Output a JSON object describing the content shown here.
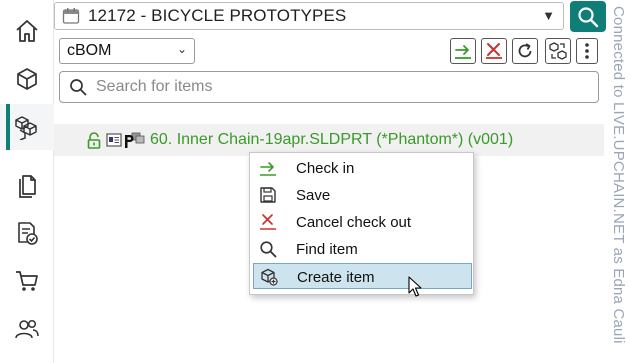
{
  "header": {
    "project_title": "12172 - BICYCLE PROTOTYPES"
  },
  "bom": {
    "selected": "cBOM"
  },
  "search": {
    "placeholder": "Search for items"
  },
  "tree": {
    "item_label": "60. Inner Chain-19apr.SLDPRT (*Phantom*) (v001)"
  },
  "context_menu": {
    "items": [
      {
        "label": "Check in",
        "icon": "check-in-arrow-icon"
      },
      {
        "label": "Save",
        "icon": "save-disk-icon"
      },
      {
        "label": "Cancel check out",
        "icon": "cancel-x-icon"
      },
      {
        "label": "Find item",
        "icon": "magnifier-icon"
      },
      {
        "label": "Create item",
        "icon": "create-item-cube-icon",
        "highlighted": true
      }
    ]
  },
  "status": {
    "connection_text": "Connected to LIVE.UPCHAIN.NET as Edna Cauli"
  },
  "colors": {
    "accent": "#0f7e76",
    "tree_text": "#3a9a2a",
    "highlight": "#cde4ef"
  },
  "nav": {
    "items": [
      "home-icon",
      "cube-icon",
      "parts-cubes-icon",
      "documents-icon",
      "checklist-document-icon",
      "cart-icon",
      "users-icon"
    ]
  }
}
